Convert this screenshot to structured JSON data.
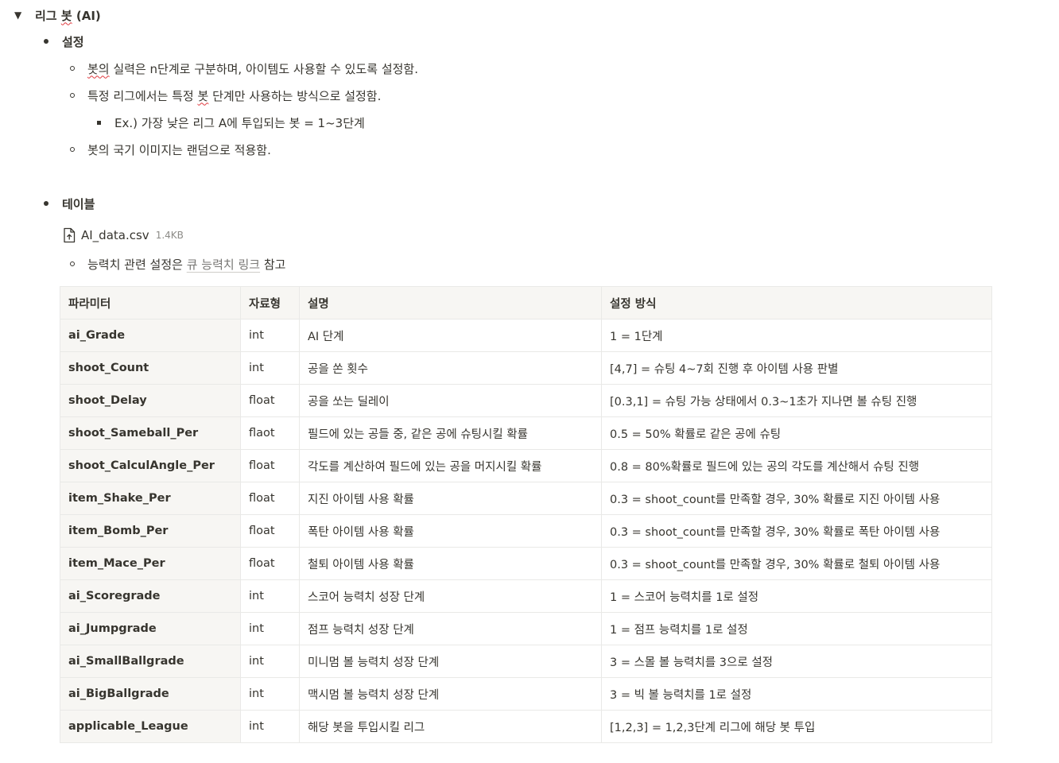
{
  "toggle": {
    "title_prefix": "리그 ",
    "title_squiggle": "봇",
    "title_suffix": " (AI)"
  },
  "settings": {
    "heading": "설정",
    "items": [
      {
        "squiggle": "봇의",
        "rest": " 실력은 n단계로 구분하며, 아이템도 사용할 수 있도록 설정함."
      },
      {
        "prefix": "특정 리그에서는 특정 ",
        "squiggle": "봇",
        "rest": " 단계만 사용하는 방식으로 설정함."
      },
      {
        "text": "Ex.) 가장 낮은 리그 A에 투입되는 봇 = 1~3단계"
      },
      {
        "text": "봇의 국기 이미지는 랜덤으로 적용함."
      }
    ]
  },
  "table_section": {
    "heading": "테이블",
    "file": {
      "name": "AI_data.csv",
      "size": "1.4KB"
    },
    "note_prefix": "능력치 관련 설정은 ",
    "note_link": "큐 능력치 링크",
    "note_suffix": " 참고"
  },
  "table": {
    "headers": [
      "파라미터",
      "자료형",
      "설명",
      "설정 방식"
    ],
    "rows": [
      [
        "ai_Grade",
        "int",
        "AI 단계",
        "1 = 1단계"
      ],
      [
        "shoot_Count",
        "int",
        "공을 쏜 횟수",
        "[4,7] = 슈팅 4~7회 진행 후 아이템 사용 판별"
      ],
      [
        "shoot_Delay",
        "float",
        "공을 쏘는 딜레이",
        "[0.3,1] = 슈팅 가능 상태에서 0.3~1초가 지나면 볼 슈팅 진행"
      ],
      [
        "shoot_Sameball_Per",
        "flaot",
        "필드에 있는 공들 중, 같은 공에 슈팅시킬 확률",
        "0.5 = 50% 확률로 같은 공에 슈팅"
      ],
      [
        "shoot_CalculAngle_Per",
        "float",
        "각도를 계산하여 필드에 있는 공을 머지시킬 확률",
        "0.8 = 80%확률로 필드에 있는 공의 각도를 계산해서 슈팅 진행"
      ],
      [
        "item_Shake_Per",
        "float",
        "지진 아이템 사용 확률",
        "0.3 = shoot_count를 만족할 경우, 30% 확률로 지진 아이템 사용"
      ],
      [
        "item_Bomb_Per",
        "float",
        "폭탄 아이템 사용 확률",
        "0.3 = shoot_count를 만족할 경우, 30% 확률로 폭탄 아이템 사용"
      ],
      [
        "item_Mace_Per",
        "float",
        "철퇴 아이템 사용 확률",
        "0.3 = shoot_count를 만족할 경우, 30% 확률로 철퇴 아이템 사용"
      ],
      [
        "ai_Scoregrade",
        "int",
        "스코어 능력치 성장 단계",
        "1 = 스코어 능력치를 1로 설정"
      ],
      [
        "ai_Jumpgrade",
        "int",
        "점프 능력치 성장 단계",
        "1 = 점프 능력치를 1로 설정"
      ],
      [
        "ai_SmallBallgrade",
        "int",
        "미니멈 볼 능력치 성장 단계",
        "3 = 스몰 볼 능력치를 3으로 설정"
      ],
      [
        "ai_BigBallgrade",
        "int",
        "맥시멈 볼 능력치 성장 단계",
        "3 = 빅 볼 능력치를 1로 설정"
      ],
      [
        "applicable_League",
        "int",
        "해당 봇을 투입시킬 리그",
        "[1,2,3] = 1,2,3단계 리그에 해당 봇 투입"
      ]
    ]
  }
}
